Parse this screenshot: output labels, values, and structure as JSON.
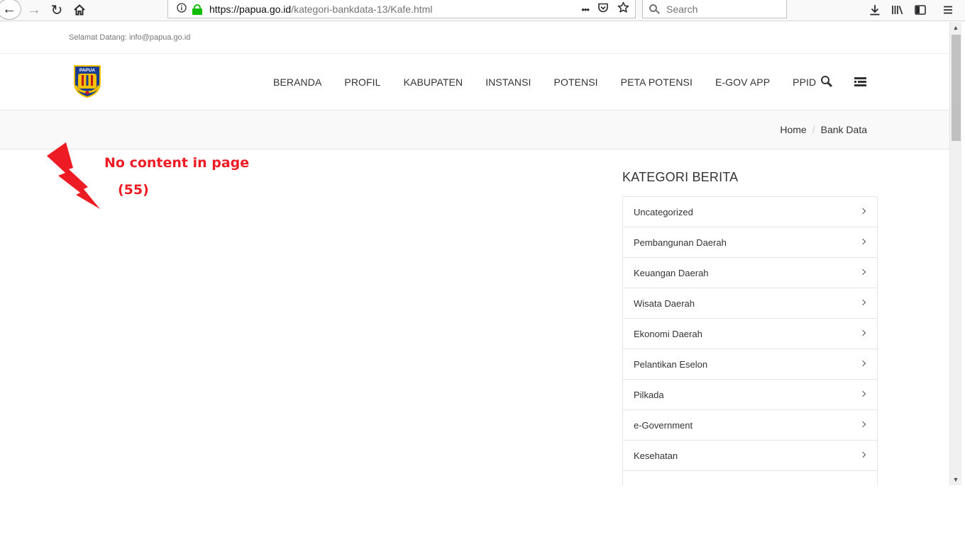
{
  "browser": {
    "url_host": "https://papua.go.id",
    "url_path": "/kategori-bankdata-13/Kafe.html",
    "search_placeholder": "Search",
    "url_actions": [
      "•••",
      "⛉",
      "☆"
    ]
  },
  "site": {
    "welcome": "Selamat Datang: info@papua.go.id",
    "logo_text": "PAPUA",
    "nav": [
      "BERANDA",
      "PROFIL",
      "KABUPATEN",
      "INSTANSI",
      "POTENSI",
      "PETA POTENSI",
      "E-GOV APP",
      "PPID"
    ],
    "breadcrumb": {
      "home": "Home",
      "separator": "/",
      "current": "Bank Data"
    }
  },
  "annotation": {
    "text": "No content in page",
    "count": "(55)",
    "color": "#ed1c24"
  },
  "sidebar": {
    "title": "KATEGORI BERITA",
    "categories": [
      "Uncategorized",
      "Pembangunan Daerah",
      "Keuangan Daerah",
      "Wisata Daerah",
      "Ekonomi Daerah",
      "Pelantikan Eselon",
      "Pilkada",
      "e-Government",
      "Kesehatan"
    ]
  },
  "icons": {
    "back": "arrow-left-icon",
    "forward": "arrow-right-icon",
    "reload": "reload-icon",
    "home": "home-icon",
    "info": "info-icon",
    "lock": "lock-icon",
    "search": "search-icon",
    "download": "download-icon",
    "library": "library-icon",
    "sidebar": "sidebar-icon",
    "menu": "hamburger-menu-icon"
  }
}
